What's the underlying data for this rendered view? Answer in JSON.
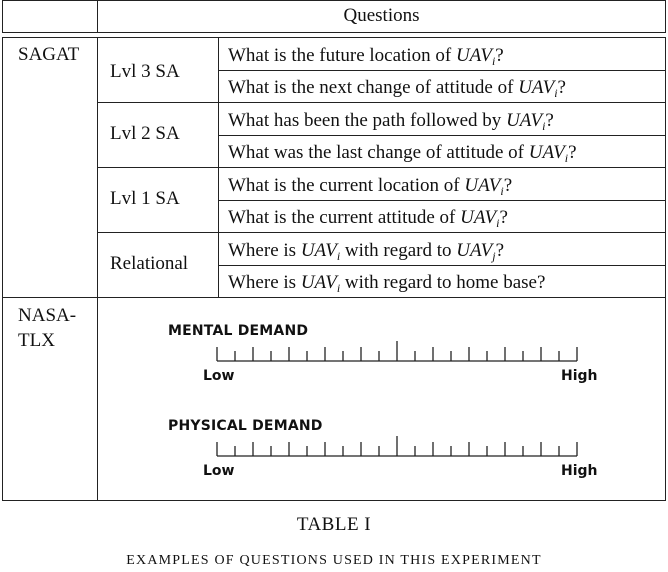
{
  "table": {
    "header": "Questions",
    "sections": [
      {
        "name": "SAGAT",
        "groups": [
          {
            "level": "Lvl 3 SA",
            "questions": [
              {
                "pre": "What is the future location of ",
                "var": "UAV",
                "sub": "i",
                "mid": "",
                "var2": "",
                "sub2": "",
                "post": "?"
              },
              {
                "pre": "What is the next change of attitude of ",
                "var": "UAV",
                "sub": "i",
                "mid": "",
                "var2": "",
                "sub2": "",
                "post": "?"
              }
            ]
          },
          {
            "level": "Lvl 2 SA",
            "questions": [
              {
                "pre": "What has been the path followed by ",
                "var": "UAV",
                "sub": "i",
                "mid": "",
                "var2": "",
                "sub2": "",
                "post": "?"
              },
              {
                "pre": "What was the last change of attitude of ",
                "var": "UAV",
                "sub": "i",
                "mid": "",
                "var2": "",
                "sub2": "",
                "post": "?"
              }
            ]
          },
          {
            "level": "Lvl 1 SA",
            "questions": [
              {
                "pre": "What is the current location of ",
                "var": "UAV",
                "sub": "i",
                "mid": "",
                "var2": "",
                "sub2": "",
                "post": "?"
              },
              {
                "pre": "What is the current attitude of ",
                "var": "UAV",
                "sub": "i",
                "mid": "",
                "var2": "",
                "sub2": "",
                "post": "?"
              }
            ]
          },
          {
            "level": "Relational",
            "questions": [
              {
                "pre": "Where is ",
                "var": "UAV",
                "sub": "i",
                "mid": " with regard to ",
                "var2": "UAV",
                "sub2": "j",
                "post": "?"
              },
              {
                "pre": "Where is ",
                "var": "UAV",
                "sub": "i",
                "mid": " with regard to home base?",
                "var2": "",
                "sub2": "",
                "post": ""
              }
            ]
          }
        ]
      },
      {
        "name_line1": "NASA-",
        "name_line2": "TLX",
        "scales": [
          {
            "title": "MENTAL DEMAND",
            "low": "Low",
            "high": "High"
          },
          {
            "title": "PHYSICAL DEMAND",
            "low": "Low",
            "high": "High"
          }
        ]
      }
    ]
  },
  "caption": {
    "title": "TABLE I",
    "subtitle": "EXAMPLES OF QUESTIONS USED IN THIS EXPERIMENT"
  }
}
